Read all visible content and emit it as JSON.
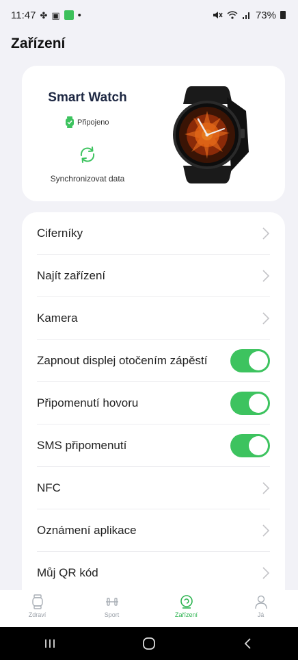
{
  "status_bar": {
    "time": "11:47",
    "dot": "•",
    "battery": "73%",
    "icons_left": [
      "fan-icon",
      "image-icon",
      "app-green-icon"
    ],
    "icons_right": [
      "mute-icon",
      "wifi-icon",
      "signal-icon",
      "battery-icon"
    ]
  },
  "header": {
    "title": "Zařízení"
  },
  "device": {
    "name": "Smart Watch",
    "connection_status": "Připojeno",
    "sync_label": "Synchronizovat data",
    "accent_color": "#3dc35f"
  },
  "settings": {
    "items": [
      {
        "label": "Ciferníky",
        "control": "chevron"
      },
      {
        "label": "Najít zařízení",
        "control": "chevron"
      },
      {
        "label": "Kamera",
        "control": "chevron"
      },
      {
        "label": "Zapnout displej otočením zápěstí",
        "control": "toggle",
        "on": true
      },
      {
        "label": "Připomenutí hovoru",
        "control": "toggle",
        "on": true
      },
      {
        "label": "SMS připomenutí",
        "control": "toggle",
        "on": true
      },
      {
        "label": "NFC",
        "control": "chevron"
      },
      {
        "label": "Oznámení aplikace",
        "control": "chevron"
      },
      {
        "label": "Můj QR kód",
        "control": "chevron"
      }
    ]
  },
  "bottom_nav": {
    "items": [
      {
        "label": "Zdraví",
        "icon": "watch-icon",
        "active": false
      },
      {
        "label": "Sport",
        "icon": "dumbbell-icon",
        "active": false
      },
      {
        "label": "Zařízení",
        "icon": "device-icon",
        "active": true
      },
      {
        "label": "Já",
        "icon": "person-icon",
        "active": false
      }
    ],
    "active_color": "#2bb34f"
  },
  "system_nav": {
    "buttons": [
      "recents-button",
      "home-button",
      "back-button"
    ]
  }
}
